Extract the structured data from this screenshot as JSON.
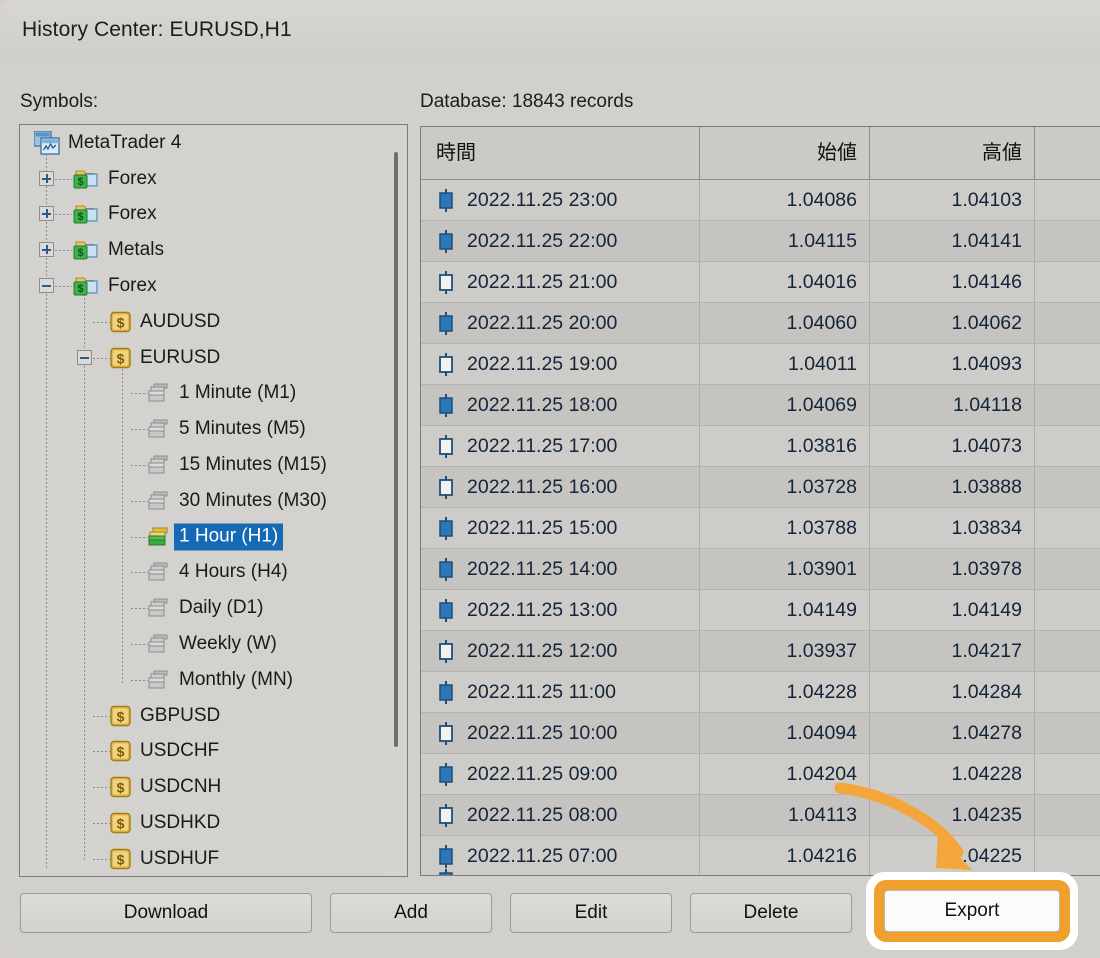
{
  "window": {
    "title": "History Center: EURUSD,H1"
  },
  "left": {
    "label": "Symbols:",
    "tree": [
      {
        "label": "MetaTrader 4",
        "depth": 0,
        "icon": "metatrader-icon",
        "expander": null,
        "selected": false
      },
      {
        "label": "Forex",
        "depth": 1,
        "icon": "folder-money-icon",
        "expander": "plus",
        "selected": false
      },
      {
        "label": "Forex",
        "depth": 1,
        "icon": "folder-money-icon",
        "expander": "plus",
        "selected": false
      },
      {
        "label": "Metals",
        "depth": 1,
        "icon": "folder-money-icon",
        "expander": "plus",
        "selected": false
      },
      {
        "label": "Forex",
        "depth": 1,
        "icon": "folder-money-icon",
        "expander": "minus",
        "selected": false
      },
      {
        "label": "AUDUSD",
        "depth": 2,
        "icon": "dollar-symbol-icon",
        "expander": null,
        "selected": false
      },
      {
        "label": "EURUSD",
        "depth": 2,
        "icon": "dollar-symbol-icon",
        "expander": "minus",
        "selected": false
      },
      {
        "label": "1 Minute (M1)",
        "depth": 3,
        "icon": "timeframe-icon",
        "expander": null,
        "selected": false
      },
      {
        "label": "5 Minutes (M5)",
        "depth": 3,
        "icon": "timeframe-icon",
        "expander": null,
        "selected": false
      },
      {
        "label": "15 Minutes (M15)",
        "depth": 3,
        "icon": "timeframe-icon",
        "expander": null,
        "selected": false
      },
      {
        "label": "30 Minutes (M30)",
        "depth": 3,
        "icon": "timeframe-icon",
        "expander": null,
        "selected": false
      },
      {
        "label": "1 Hour (H1)",
        "depth": 3,
        "icon": "timeframe-active-icon",
        "expander": null,
        "selected": true
      },
      {
        "label": "4 Hours (H4)",
        "depth": 3,
        "icon": "timeframe-icon",
        "expander": null,
        "selected": false
      },
      {
        "label": "Daily (D1)",
        "depth": 3,
        "icon": "timeframe-icon",
        "expander": null,
        "selected": false
      },
      {
        "label": "Weekly (W)",
        "depth": 3,
        "icon": "timeframe-icon",
        "expander": null,
        "selected": false
      },
      {
        "label": "Monthly (MN)",
        "depth": 3,
        "icon": "timeframe-icon",
        "expander": null,
        "selected": false
      },
      {
        "label": "GBPUSD",
        "depth": 2,
        "icon": "dollar-symbol-icon",
        "expander": null,
        "selected": false
      },
      {
        "label": "USDCHF",
        "depth": 2,
        "icon": "dollar-symbol-icon",
        "expander": null,
        "selected": false
      },
      {
        "label": "USDCNH",
        "depth": 2,
        "icon": "dollar-symbol-icon",
        "expander": null,
        "selected": false
      },
      {
        "label": "USDHKD",
        "depth": 2,
        "icon": "dollar-symbol-icon",
        "expander": null,
        "selected": false
      },
      {
        "label": "USDHUF",
        "depth": 2,
        "icon": "dollar-symbol-icon",
        "expander": null,
        "selected": false
      }
    ]
  },
  "right": {
    "label": "Database: 18843 records",
    "columns": [
      "時間",
      "始値",
      "高値",
      ""
    ],
    "rows": [
      {
        "time": "2022.11.25 23:00",
        "open": "1.04086",
        "high": "1.04103",
        "extra": "",
        "candle": "filled"
      },
      {
        "time": "2022.11.25 22:00",
        "open": "1.04115",
        "high": "1.04141",
        "extra": "",
        "candle": "filled"
      },
      {
        "time": "2022.11.25 21:00",
        "open": "1.04016",
        "high": "1.04146",
        "extra": "",
        "candle": "hollow"
      },
      {
        "time": "2022.11.25 20:00",
        "open": "1.04060",
        "high": "1.04062",
        "extra": "",
        "candle": "filled"
      },
      {
        "time": "2022.11.25 19:00",
        "open": "1.04011",
        "high": "1.04093",
        "extra": "",
        "candle": "hollow"
      },
      {
        "time": "2022.11.25 18:00",
        "open": "1.04069",
        "high": "1.04118",
        "extra": "",
        "candle": "filled"
      },
      {
        "time": "2022.11.25 17:00",
        "open": "1.03816",
        "high": "1.04073",
        "extra": "",
        "candle": "hollow"
      },
      {
        "time": "2022.11.25 16:00",
        "open": "1.03728",
        "high": "1.03888",
        "extra": "",
        "candle": "hollow"
      },
      {
        "time": "2022.11.25 15:00",
        "open": "1.03788",
        "high": "1.03834",
        "extra": "",
        "candle": "filled"
      },
      {
        "time": "2022.11.25 14:00",
        "open": "1.03901",
        "high": "1.03978",
        "extra": "",
        "candle": "filled"
      },
      {
        "time": "2022.11.25 13:00",
        "open": "1.04149",
        "high": "1.04149",
        "extra": "",
        "candle": "filled"
      },
      {
        "time": "2022.11.25 12:00",
        "open": "1.03937",
        "high": "1.04217",
        "extra": "",
        "candle": "hollow"
      },
      {
        "time": "2022.11.25 11:00",
        "open": "1.04228",
        "high": "1.04284",
        "extra": "",
        "candle": "filled"
      },
      {
        "time": "2022.11.25 10:00",
        "open": "1.04094",
        "high": "1.04278",
        "extra": "",
        "candle": "hollow"
      },
      {
        "time": "2022.11.25 09:00",
        "open": "1.04204",
        "high": "1.04228",
        "extra": "",
        "candle": "filled"
      },
      {
        "time": "2022.11.25 08:00",
        "open": "1.04113",
        "high": "1.04235",
        "extra": "",
        "candle": "hollow"
      },
      {
        "time": "2022.11.25 07:00",
        "open": "1.04216",
        "high": "1.04225",
        "extra": "",
        "candle": "filled"
      }
    ]
  },
  "buttons": {
    "download": "Download",
    "add": "Add",
    "edit": "Edit",
    "delete": "Delete",
    "export": "Export"
  },
  "annotation": {
    "arrow": "arrow-pointing-to-export",
    "highlight_color": "#f0a02e"
  }
}
